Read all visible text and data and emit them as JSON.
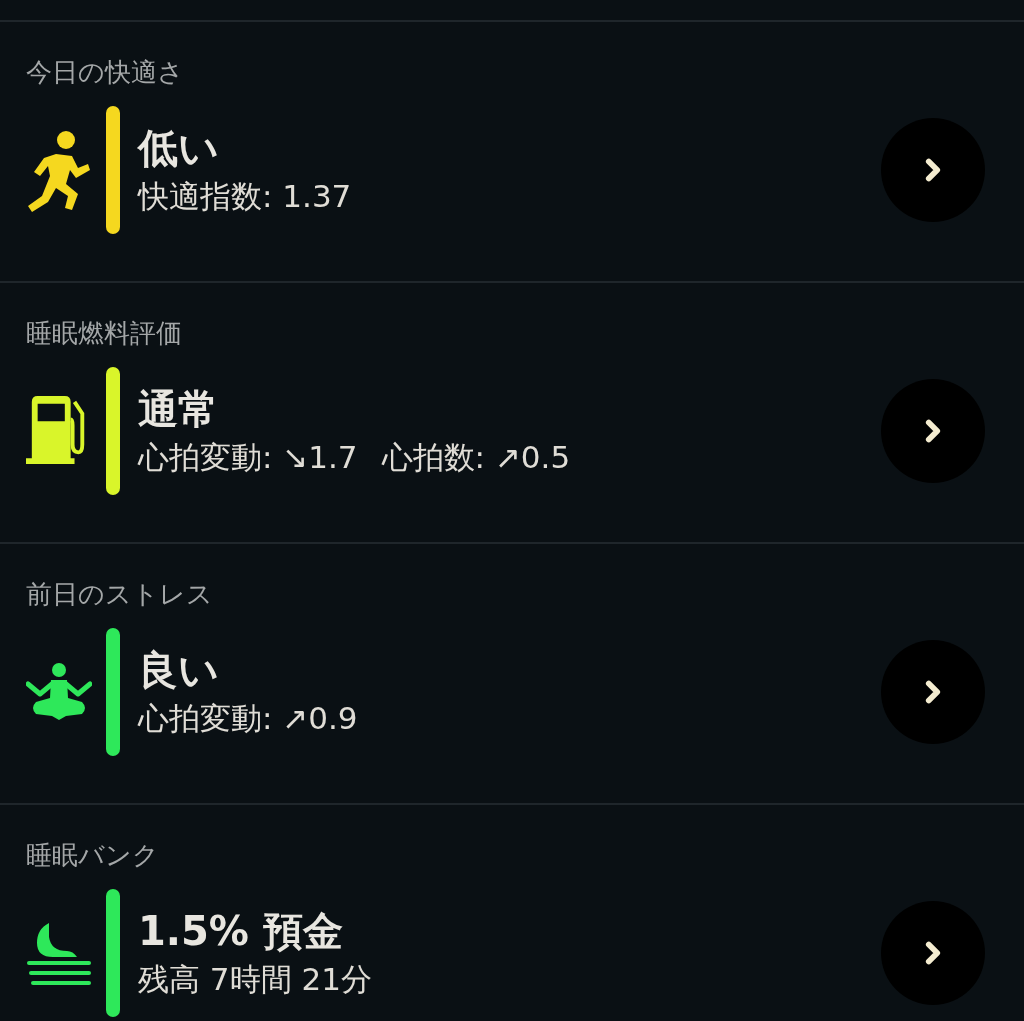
{
  "sections": [
    {
      "title": "今日の快適さ",
      "kind": "running",
      "color": "#f5d81f",
      "status": "低い",
      "details": [
        "快適指数: 1.37"
      ]
    },
    {
      "title": "睡眠燃料評価",
      "kind": "fuel",
      "color": "#d9f52a",
      "status": "通常",
      "details": [
        "心拍変動: ↘1.7",
        "心拍数: ↗0.5"
      ]
    },
    {
      "title": "前日のストレス",
      "kind": "meditation",
      "color": "#2ee85a",
      "status": "良い",
      "details": [
        "心拍変動: ↗0.9"
      ]
    },
    {
      "title": "睡眠バンク",
      "kind": "sleep",
      "color": "#2ee85a",
      "status": "1.5% 預金",
      "details": [
        "残高 7時間 21分"
      ]
    }
  ]
}
